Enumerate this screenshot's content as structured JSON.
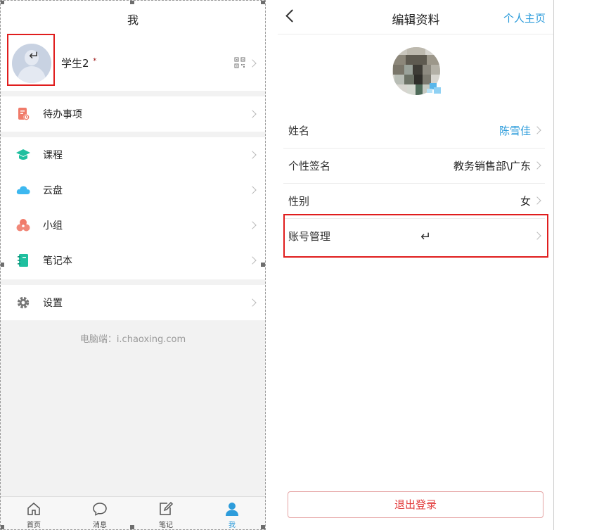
{
  "left": {
    "header": {
      "title": "我"
    },
    "profile": {
      "name": "学生2",
      "mark": "*",
      "return_glyph": "↵",
      "avatar_icon": "default-avatar-icon",
      "qr_icon": "qr-code-icon"
    },
    "menu_groups": [
      {
        "items": [
          {
            "label": "待办事项",
            "icon": "todo-icon",
            "color": "#f07b6a"
          }
        ]
      },
      {
        "items": [
          {
            "label": "课程",
            "icon": "course-cap-icon",
            "color": "#1fbf9f"
          },
          {
            "label": "云盘",
            "icon": "cloud-icon",
            "color": "#3db8f0"
          },
          {
            "label": "小组",
            "icon": "group-icon",
            "color": "#f07b6a"
          },
          {
            "label": "笔记本",
            "icon": "notebook-icon",
            "color": "#1fbf9f"
          }
        ]
      },
      {
        "items": [
          {
            "label": "设置",
            "icon": "settings-gear-icon",
            "color": "#777777"
          }
        ]
      }
    ],
    "footer": {
      "text": "电脑端：i.chaoxing.com"
    },
    "tabbar": [
      {
        "label": "首页",
        "icon": "home-icon",
        "active": false
      },
      {
        "label": "消息",
        "icon": "message-icon",
        "active": false
      },
      {
        "label": "笔记",
        "icon": "note-edit-icon",
        "active": false
      },
      {
        "label": "我",
        "icon": "me-person-icon",
        "active": true
      }
    ]
  },
  "right": {
    "header": {
      "back_icon": "back-chevron-icon",
      "title": "编辑资料",
      "home_link": "个人主页"
    },
    "fields": [
      {
        "label": "姓名",
        "value": "陈雪佳",
        "accent": true
      },
      {
        "label": "个性签名",
        "value": "教务销售部\\广东",
        "accent": false
      },
      {
        "label": "性别",
        "value": "女",
        "accent": false
      },
      {
        "label": "账号管理",
        "value": "",
        "accent": false
      }
    ],
    "return_glyph": "↵",
    "logout_label": "退出登录"
  },
  "colors": {
    "accent": "#2d9cdb",
    "highlight_box": "#e01d1d",
    "logout": "#e23b3b",
    "active_tab": "#2d9cdb"
  }
}
